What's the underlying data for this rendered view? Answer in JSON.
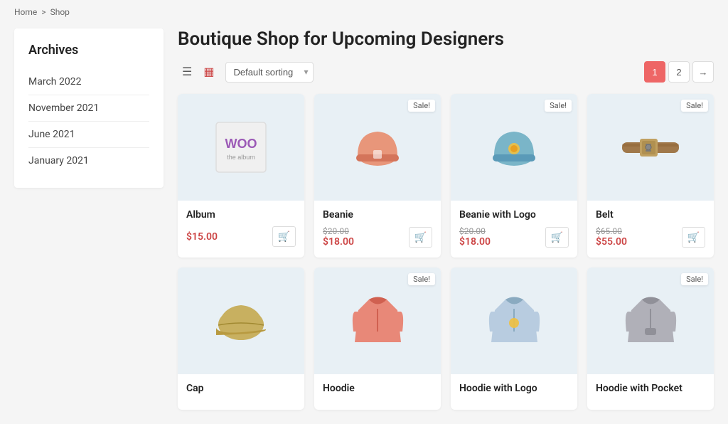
{
  "breadcrumb": {
    "home": "Home",
    "sep": ">",
    "current": "Shop"
  },
  "sidebar": {
    "title": "Archives",
    "items": [
      {
        "label": "March 2022"
      },
      {
        "label": "November 2021"
      },
      {
        "label": "June 2021"
      },
      {
        "label": "January 2021"
      }
    ]
  },
  "main": {
    "title": "Boutique Shop for Upcoming Designers",
    "sort_default": "Default sorting",
    "pagination": [
      "1",
      "2",
      "→"
    ],
    "products": [
      {
        "name": "Album",
        "sale": false,
        "price_single": "$15.00",
        "price_original": null,
        "price_sale": null,
        "image_type": "album"
      },
      {
        "name": "Beanie",
        "sale": true,
        "price_single": null,
        "price_original": "$20.00",
        "price_sale": "$18.00",
        "image_type": "beanie-pink"
      },
      {
        "name": "Beanie with Logo",
        "sale": true,
        "price_single": null,
        "price_original": "$20.00",
        "price_sale": "$18.00",
        "image_type": "beanie-blue"
      },
      {
        "name": "Belt",
        "sale": true,
        "price_single": null,
        "price_original": "$65.00",
        "price_sale": "$55.00",
        "image_type": "belt"
      },
      {
        "name": "Cap",
        "sale": false,
        "price_single": null,
        "price_original": null,
        "price_sale": null,
        "image_type": "cap"
      },
      {
        "name": "Hoodie",
        "sale": true,
        "price_single": null,
        "price_original": null,
        "price_sale": null,
        "image_type": "hoodie-pink"
      },
      {
        "name": "Hoodie with Logo",
        "sale": false,
        "price_single": null,
        "price_original": null,
        "price_sale": null,
        "image_type": "hoodie-blue"
      },
      {
        "name": "Hoodie with Pocket",
        "sale": true,
        "price_single": null,
        "price_original": null,
        "price_sale": null,
        "image_type": "hoodie-grey"
      }
    ],
    "sale_label": "Sale!",
    "view_list_icon": "☰",
    "view_grid_icon": "⊞"
  }
}
